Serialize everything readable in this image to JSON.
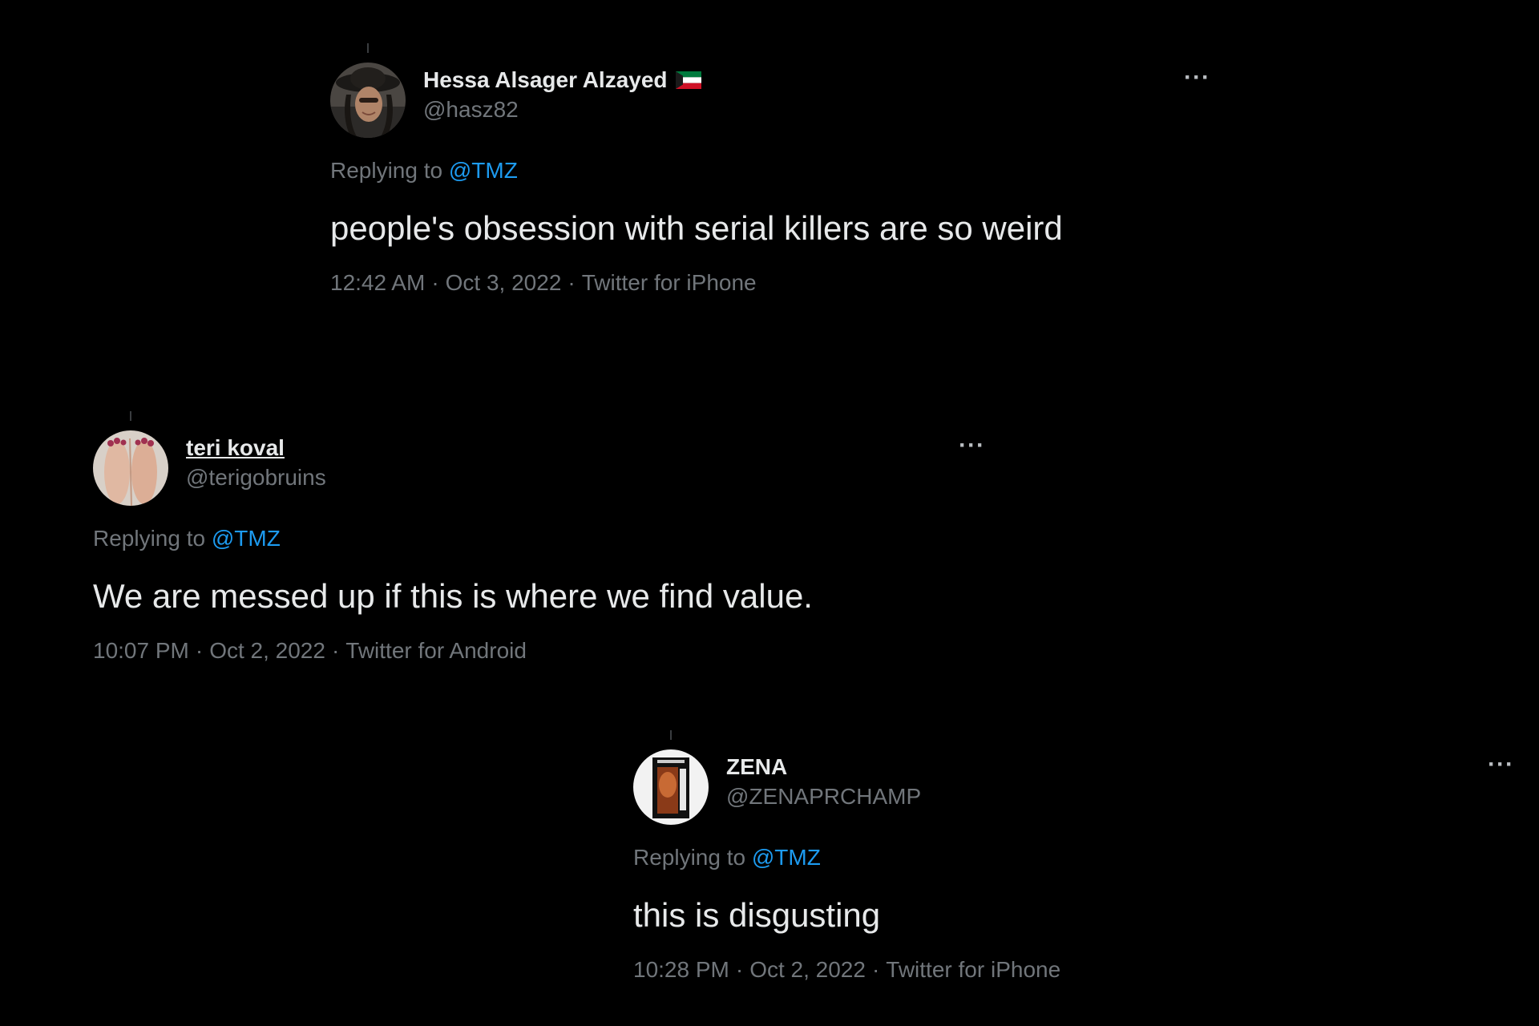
{
  "tweets": [
    {
      "display_name": "Hessa Alsager Alzayed",
      "has_flag_emoji": true,
      "flag": "kuwait-flag",
      "handle": "@hasz82",
      "more_label": "···",
      "replying_prefix": "Replying to",
      "replying_mention": "@TMZ",
      "text": "people's obsession with serial killers are so weird",
      "time": "12:42 AM",
      "separator": "·",
      "date": "Oct 3, 2022",
      "source": "Twitter for iPhone"
    },
    {
      "display_name": "teri koval",
      "handle": "@terigobruins",
      "more_label": "···",
      "replying_prefix": "Replying to",
      "replying_mention": "@TMZ",
      "text": "We are messed up if this is where we find value.",
      "time": "10:07 PM",
      "separator": "·",
      "date": "Oct 2, 2022",
      "source": "Twitter for Android"
    },
    {
      "display_name": "ZENA",
      "handle": "@ZENAPRCHAMP",
      "more_label": "···",
      "replying_prefix": "Replying to",
      "replying_mention": "@TMZ",
      "text": "this is disgusting",
      "time": "10:28 PM",
      "separator": "·",
      "date": "Oct 2, 2022",
      "source": "Twitter for iPhone"
    }
  ],
  "colors": {
    "background": "#000000",
    "primary_text": "#e7e9ea",
    "secondary_text": "#71767b",
    "mention": "#1d9bf0"
  }
}
